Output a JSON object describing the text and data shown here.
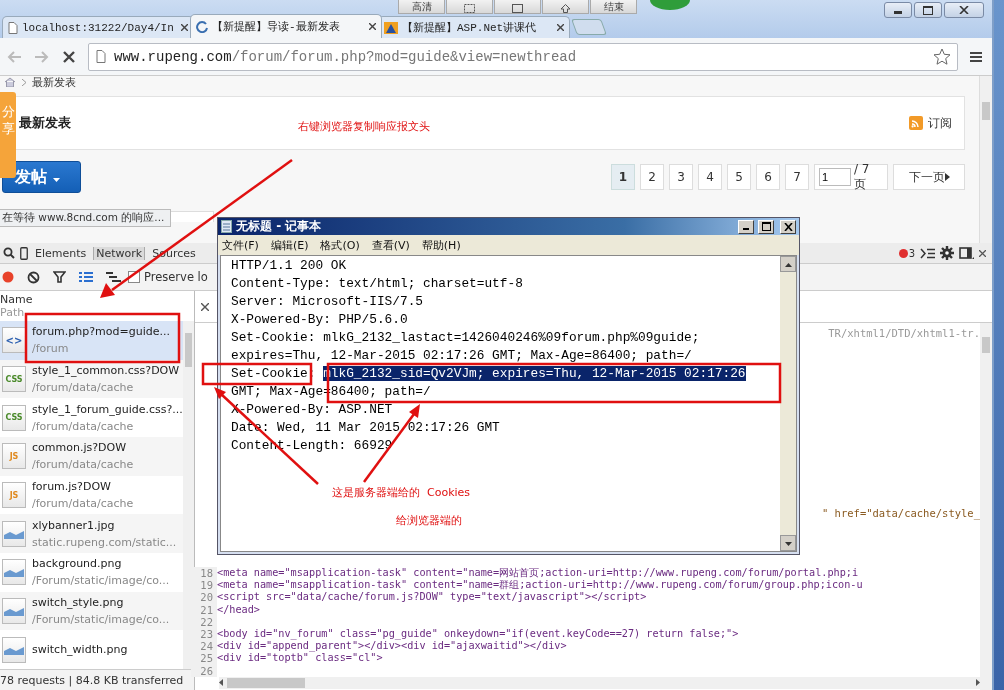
{
  "video_toolbar": {
    "quality": "高清",
    "end": "结束"
  },
  "browser": {
    "tabs": [
      {
        "title": "localhost:31222/Day4/In",
        "kind": "page",
        "selected": false
      },
      {
        "title": "【新提醒】导读-最新发表",
        "kind": "loading",
        "selected": true
      },
      {
        "title": "【新提醒】ASP.Net讲课代",
        "kind": "site",
        "selected": false
      }
    ],
    "loading": true,
    "url_host": "www.rupeng.com",
    "url_path": "/forum/forum.php?mod=guide&view=newthread"
  },
  "page": {
    "breadcrumb": "最新发表",
    "share_tab": "分享",
    "heading": "最新发表",
    "subscribe": "订阅",
    "post_button": "发帖",
    "pages": [
      {
        "label": "1",
        "selected": true
      },
      {
        "label": "2",
        "selected": false
      },
      {
        "label": "3",
        "selected": false
      },
      {
        "label": "4",
        "selected": false
      },
      {
        "label": "5",
        "selected": false
      },
      {
        "label": "6",
        "selected": false
      },
      {
        "label": "7",
        "selected": false
      }
    ],
    "page_input": "1",
    "page_total": "/ 7 页",
    "next": "下一页",
    "status": "在等待 www.8cnd.com 的响应..."
  },
  "devtools": {
    "tabs": [
      {
        "label": "Elements",
        "selected": false
      },
      {
        "label": "Network",
        "selected": true
      },
      {
        "label": "Sources",
        "selected": false
      }
    ],
    "error_count": "3",
    "recording": true,
    "preserve_log": {
      "label": "Preserve lo",
      "checked": false
    },
    "name_header": "Name",
    "path_header": "Path",
    "requests": [
      {
        "name": "forum.php?mod=guide...",
        "path": "/forum",
        "kind": "html",
        "icon_text": "<>",
        "selected": true
      },
      {
        "name": "style_1_common.css?DOW",
        "path": "/forum/data/cache",
        "kind": "css",
        "icon_text": "CSS",
        "selected": false
      },
      {
        "name": "style_1_forum_guide.css?...",
        "path": "/forum/data/cache",
        "kind": "css",
        "icon_text": "CSS",
        "selected": false
      },
      {
        "name": "common.js?DOW",
        "path": "/forum/data/cache",
        "kind": "js",
        "icon_text": "JS",
        "selected": false
      },
      {
        "name": "forum.js?DOW",
        "path": "/forum/data/cache",
        "kind": "js",
        "icon_text": "JS",
        "selected": false
      },
      {
        "name": "xlybanner1.jpg",
        "path": "static.rupeng.com/static...",
        "kind": "image",
        "selected": false
      },
      {
        "name": "background.png",
        "path": "/Forum/static/image/co...",
        "kind": "image",
        "selected": false
      },
      {
        "name": "switch_style.png",
        "path": "/Forum/static/image/co...",
        "kind": "image",
        "selected": false
      },
      {
        "name": "switch_width.png",
        "kind": "image",
        "selected": false
      }
    ],
    "footer": "78 requests | 84.8 KB transferred",
    "response_fragments": [
      "TR/xhtml1/DTD/xhtml1-tr.",
      "\" href=\"data/cache/style_"
    ],
    "code_lines": [
      {
        "number": "18",
        "text": "<meta name=\"msapplication-task\" content=\"name=网站首页;action-uri=http://www.rupeng.com/forum/portal.php;i"
      },
      {
        "number": "19",
        "text": "<meta name=\"msapplication-task\" content=\"name=群组;action-uri=http://www.rupeng.com/forum/group.php;icon-u"
      },
      {
        "number": "20",
        "text": "<script src=\"data/cache/forum.js?DOW\" type=\"text/javascript\"></script>"
      },
      {
        "number": "21",
        "text": "</head>"
      },
      {
        "number": "22"
      },
      {
        "number": "23",
        "text": "<body id=\"nv_forum\" class=\"pg_guide\" onkeydown=\"if(event.keyCode==27) return false;\">"
      },
      {
        "number": "24",
        "text": "<div id=\"append_parent\"></div><div id=\"ajaxwaitid\"></div>"
      },
      {
        "number": "25",
        "text": "<div id=\"toptb\" class=\"cl\">"
      },
      {
        "number": "26"
      }
    ]
  },
  "notepad": {
    "title": "无标题 - 记事本",
    "menu": [
      "文件(F)",
      "编辑(E)",
      "格式(O)",
      "查看(V)",
      "帮助(H)"
    ],
    "lines": [
      {
        "parts": [
          {
            "text": "HTTP/1.1 200 OK",
            "selected": false
          }
        ]
      },
      {
        "parts": [
          {
            "text": "Content-Type: text/html; charset=utf-8",
            "selected": false
          }
        ]
      },
      {
        "parts": [
          {
            "text": "Server: Microsoft-IIS/7.5",
            "selected": false
          }
        ]
      },
      {
        "parts": [
          {
            "text": "X-Powered-By: PHP/5.6.0",
            "selected": false
          }
        ]
      },
      {
        "parts": [
          {
            "text": "Set-Cookie: mlkG_2132_lastact=1426040246%09forum.php%09guide;",
            "selected": false
          }
        ]
      },
      {
        "parts": [
          {
            "text": "expires=Thu, 12-Mar-2015 02:17:26 GMT; Max-Age=86400; path=/",
            "selected": false
          }
        ]
      },
      {
        "parts": [
          {
            "text": "Set-Cookie: ",
            "selected": false
          },
          {
            "text": "mlkG_2132_sid=Qv2VJm; expires=Thu, 12-Mar-2015 02:17:26",
            "selected": true
          }
        ]
      },
      {
        "parts": [
          {
            "text": "GMT; Max-Age=86400; path=/",
            "selected": false
          }
        ]
      },
      {
        "parts": [
          {
            "text": "X-Powered-By: ASP.NET",
            "selected": false
          }
        ]
      },
      {
        "parts": [
          {
            "text": "Date: Wed, 11 Mar 2015 02:17:26 GMT",
            "selected": false
          }
        ]
      },
      {
        "parts": [
          {
            "text": "Content-Length: 66929",
            "selected": false
          }
        ]
      }
    ]
  },
  "annotations": [
    "右键浏览器复制响应报文头",
    "这是服务器端给的  Cookies",
    "给浏览器端的"
  ]
}
